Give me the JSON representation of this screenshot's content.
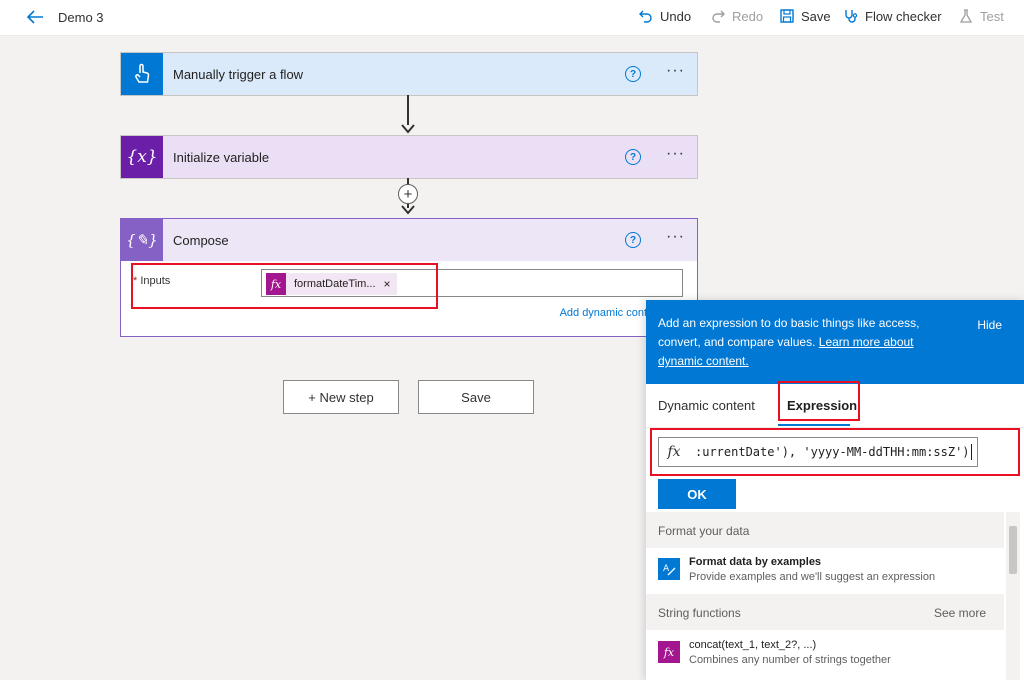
{
  "toolbar": {
    "flow_name": "Demo 3",
    "undo": "Undo",
    "redo": "Redo",
    "save": "Save",
    "flow_checker": "Flow checker",
    "test": "Test"
  },
  "cards": {
    "trigger": {
      "title": "Manually trigger a flow",
      "color": "#0078d4",
      "icon": "touch-icon"
    },
    "init_var": {
      "title": "Initialize variable",
      "color": "#6b1fa8",
      "icon": "variable-icon"
    },
    "compose": {
      "title": "Compose",
      "color": "#8661c5",
      "icon": "compose-icon",
      "inputs_required": "*",
      "inputs_label": "Inputs",
      "token_label": "formatDateTim...",
      "token_remove": "×",
      "add_dynamic": "Add dynamic cont"
    }
  },
  "buttons": {
    "new_step": "+ New step",
    "save": "Save"
  },
  "panel": {
    "banner_text": "Add an expression to do basic things like access, convert, and compare values.",
    "learn_more": "Learn more about dynamic content.",
    "hide": "Hide",
    "tabs": [
      "Dynamic content",
      "Expression"
    ],
    "active_tab": "Expression",
    "expression_value": ":urrentDate'), 'yyyy-MM-ddTHH:mm:ssZ')",
    "ok": "OK",
    "sections": [
      {
        "header": "Format your data",
        "see_more": "",
        "items": [
          {
            "title": "Format data by examples",
            "description": "Provide examples and we'll suggest an expression"
          }
        ]
      },
      {
        "header": "String functions",
        "see_more": "See more",
        "items": [
          {
            "title": "concat(text_1, text_2?, ...)",
            "description": "Combines any number of strings together"
          }
        ]
      }
    ]
  },
  "colors": {
    "accent": "#0078d4",
    "highlight": "#e81123",
    "expression_fx": "#a4168f"
  }
}
